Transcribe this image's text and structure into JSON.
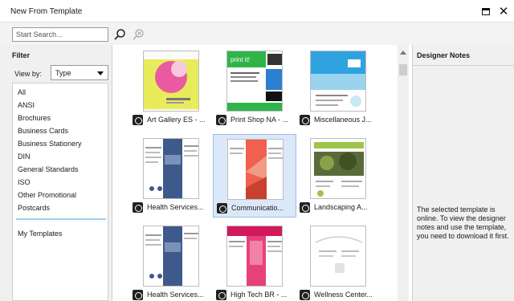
{
  "window": {
    "title": "New From Template"
  },
  "search": {
    "placeholder": "Start Search..."
  },
  "filter": {
    "heading": "Filter",
    "view_by_label": "View by:",
    "view_by_value": "Type",
    "items": [
      "All",
      "ANSI",
      "Brochures",
      "Business Cards",
      "Business Stationery",
      "DIN",
      "General Standards",
      "ISO",
      "Other Promotional",
      "Postcards"
    ],
    "my_templates": "My Templates"
  },
  "templates": [
    {
      "label": "Art Gallery ES - ...",
      "selected": false
    },
    {
      "label": "Print Shop NA - ...",
      "selected": false
    },
    {
      "label": "Miscellaneous J...",
      "selected": false
    },
    {
      "label": "Health Services...",
      "selected": false
    },
    {
      "label": "Communicatio...",
      "selected": true
    },
    {
      "label": "Landscaping A...",
      "selected": false
    },
    {
      "label": "Health Services...",
      "selected": false
    },
    {
      "label": "High Tech BR - ...",
      "selected": false
    },
    {
      "label": "Wellness Center...",
      "selected": false
    }
  ],
  "designer_notes": {
    "heading": "Designer Notes",
    "body": "The selected template is online. To view the designer notes and use the template, you need to download it first."
  },
  "colors": {
    "selection_bg": "#dbe8f7",
    "selection_border": "#9cbde6",
    "panel_bg": "#f0f0f0",
    "separator": "#9fd0ea"
  },
  "icons": {
    "search": "magnifier-icon",
    "clear": "clear-search-icon",
    "online": "online-template-icon"
  }
}
